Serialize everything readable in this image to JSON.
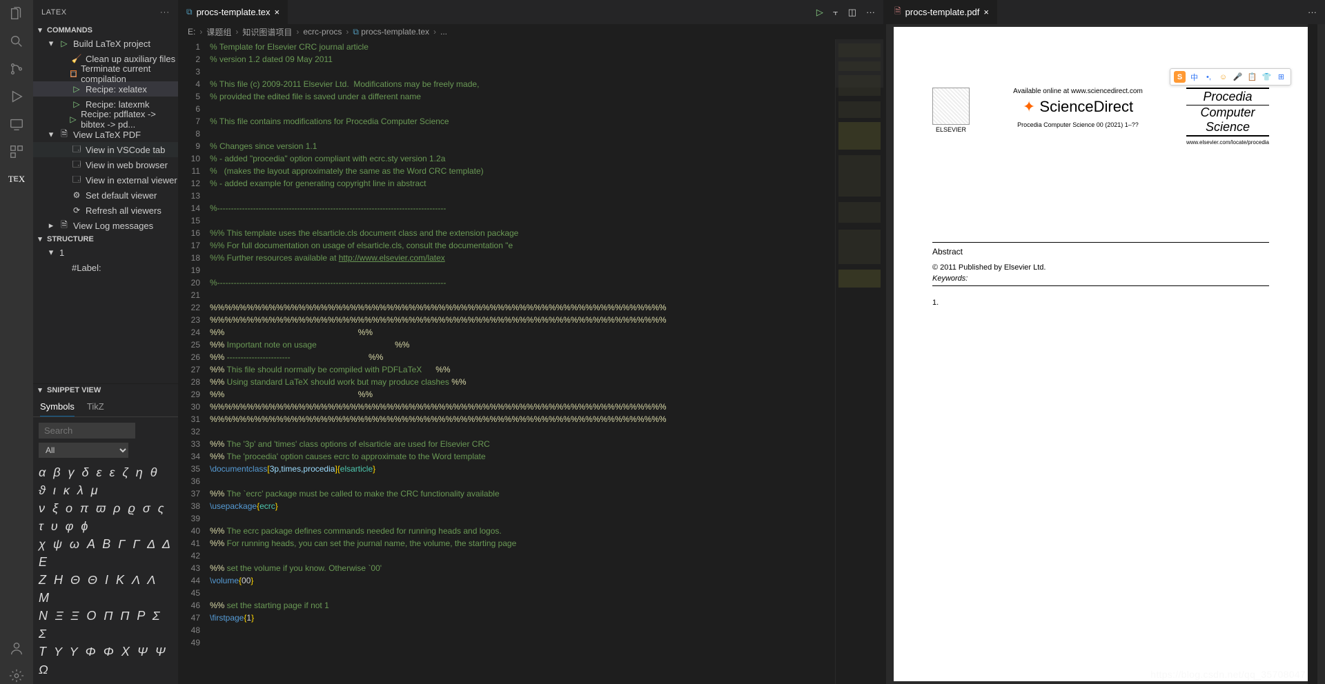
{
  "activity_icons": [
    "files",
    "search",
    "scm",
    "debug",
    "remote",
    "extensions",
    "tex"
  ],
  "activity_bottom": [
    "account",
    "settings"
  ],
  "sidebar": {
    "title": "LATEX",
    "commands_hdr": "COMMANDS",
    "structure_hdr": "STRUCTURE",
    "snippet_hdr": "SNIPPET VIEW",
    "tree": [
      {
        "chev": "▾",
        "icon": "▷",
        "iconCls": "play",
        "label": "Build LaTeX project"
      },
      {
        "chev": "",
        "icon": "🧹",
        "iconCls": "doc",
        "label": "Clean up auxiliary files",
        "child": true
      },
      {
        "chev": "",
        "icon": "□",
        "iconCls": "stop",
        "label": "Terminate current compilation",
        "child": true
      },
      {
        "chev": "",
        "icon": "▷",
        "iconCls": "play",
        "label": "Recipe: xelatex",
        "child": true,
        "sel": true
      },
      {
        "chev": "",
        "icon": "▷",
        "iconCls": "play",
        "label": "Recipe: latexmk",
        "child": true
      },
      {
        "chev": "",
        "icon": "▷",
        "iconCls": "play",
        "label": "Recipe: pdflatex -> bibtex -> pd...",
        "child": true
      },
      {
        "chev": "▾",
        "icon": "🗎",
        "iconCls": "doc",
        "label": "View LaTeX PDF"
      },
      {
        "chev": "",
        "icon": "🗔",
        "iconCls": "doc",
        "label": "View in VSCode tab",
        "child": true,
        "hover": true
      },
      {
        "chev": "",
        "icon": "🗔",
        "iconCls": "doc",
        "label": "View in web browser",
        "child": true
      },
      {
        "chev": "",
        "icon": "🗔",
        "iconCls": "doc",
        "label": "View in external viewer",
        "child": true
      },
      {
        "chev": "",
        "icon": "⚙",
        "iconCls": "gear",
        "label": "Set default viewer",
        "child": true
      },
      {
        "chev": "",
        "icon": "⟳",
        "iconCls": "refresh",
        "label": "Refresh all viewers",
        "child": true
      },
      {
        "chev": "▸",
        "icon": "🗎",
        "iconCls": "doc",
        "label": "View Log messages"
      }
    ],
    "structure": [
      {
        "chev": "▾",
        "label": "1"
      },
      {
        "chev": "",
        "label": "#Label:",
        "child": true
      }
    ],
    "snippet": {
      "tabs": [
        "Symbols",
        "TikZ"
      ],
      "search_ph": "Search",
      "filter_value": "All",
      "rows": [
        "α β γ δ ε ε ζ η θ ϑ ι κ λ μ",
        "ν ξ ο π ϖ ρ ϱ σ ς τ υ φ ϕ",
        "χ ψ ω A B Γ Γ Δ Δ E",
        "Z H Θ Θ I K Λ Λ M",
        "N Ξ Ξ O Π Π P Σ Σ",
        "T Υ Υ Φ Φ X Ψ Ψ Ω"
      ]
    }
  },
  "editor": {
    "tab_label": "procs-template.tex",
    "pdf_tab_label": "procs-template.pdf",
    "breadcrumb": [
      "E:",
      "课题组",
      "知识图谱项目",
      "ecrc-procs",
      "procs-template.tex",
      "..."
    ],
    "lines": [
      {
        "n": 1,
        "html": "<span class='c-comment'></span>"
      },
      {
        "n": 2,
        "html": "<span class='c-comment'>% Template for Elsevier CRC journal article</span>"
      },
      {
        "n": 3,
        "html": "<span class='c-comment'>% version 1.2 dated 09 May 2011</span>"
      },
      {
        "n": 4,
        "html": ""
      },
      {
        "n": 5,
        "html": "<span class='c-comment'>% This file (c) 2009-2011 Elsevier Ltd.  Modifications may be freely made,</span>"
      },
      {
        "n": 6,
        "html": "<span class='c-comment'>% provided the edited file is saved under a different name</span>"
      },
      {
        "n": 7,
        "html": ""
      },
      {
        "n": 8,
        "html": "<span class='c-comment'>% This file contains modifications for Procedia Computer Science</span>"
      },
      {
        "n": 9,
        "html": ""
      },
      {
        "n": 10,
        "html": "<span class='c-comment'>% Changes since version 1.1</span>"
      },
      {
        "n": 11,
        "html": "<span class='c-comment'>% - added \"procedia\" option compliant with ecrc.sty version 1.2a</span>"
      },
      {
        "n": 12,
        "html": "<span class='c-comment'>%   (makes the layout approximately the same as the Word CRC template)</span>"
      },
      {
        "n": 13,
        "html": "<span class='c-comment'>% - added example for generating copyright line in abstract</span>"
      },
      {
        "n": 14,
        "html": ""
      },
      {
        "n": 15,
        "html": "<span class='c-comment'>%-----------------------------------------------------------------------------------</span>"
      },
      {
        "n": 16,
        "html": ""
      },
      {
        "n": 17,
        "html": "<span class='c-comment'>%% This template uses the elsarticle.cls document class and the extension package</span>"
      },
      {
        "n": 18,
        "html": "<span class='c-comment'>%% For full documentation on usage of elsarticle.cls, consult the documentation \"e</span>"
      },
      {
        "n": 19,
        "html": "<span class='c-comment'>%% Further resources available at </span><span class='c-url'>http://www.elsevier.com/latex</span>"
      },
      {
        "n": 20,
        "html": ""
      },
      {
        "n": 21,
        "html": "<span class='c-comment'>%-----------------------------------------------------------------------------------</span>"
      },
      {
        "n": 22,
        "html": ""
      },
      {
        "n": 23,
        "html": "<span class='c-pct'>%%%%%%%%%%%%%%%%%%%%%%%%%%%%%%%%%%%%%%%%%%%%%%%%%%%%%%%%%%%%%%</span>"
      },
      {
        "n": 24,
        "html": "<span class='c-pct'>%%%%%%%%%%%%%%%%%%%%%%%%%%%%%%%%%%%%%%%%%%%%%%%%%%%%%%%%%%%%%%</span>"
      },
      {
        "n": 25,
        "html": "<span class='c-pct'>%%</span>                                                          <span class='c-pct'>%%</span>"
      },
      {
        "n": 26,
        "html": "<span class='c-pct'>%%</span><span class='c-comment'> Important note on usage                                  </span><span class='c-pct'>%%</span>"
      },
      {
        "n": 27,
        "html": "<span class='c-pct'>%%</span><span class='c-comment'> -----------------------                                  </span><span class='c-pct'>%%</span>"
      },
      {
        "n": 28,
        "html": "<span class='c-pct'>%%</span><span class='c-comment'> This file should normally be compiled with PDFLaTeX      </span><span class='c-pct'>%%</span>"
      },
      {
        "n": 29,
        "html": "<span class='c-pct'>%%</span><span class='c-comment'> Using standard LaTeX should work but may produce clashes </span><span class='c-pct'>%%</span>"
      },
      {
        "n": 30,
        "html": "<span class='c-pct'>%%</span>                                                          <span class='c-pct'>%%</span>"
      },
      {
        "n": 31,
        "html": "<span class='c-pct'>%%%%%%%%%%%%%%%%%%%%%%%%%%%%%%%%%%%%%%%%%%%%%%%%%%%%%%%%%%%%%%</span>"
      },
      {
        "n": 32,
        "html": "<span class='c-pct'>%%%%%%%%%%%%%%%%%%%%%%%%%%%%%%%%%%%%%%%%%%%%%%%%%%%%%%%%%%%%%%</span>"
      },
      {
        "n": 33,
        "html": ""
      },
      {
        "n": 34,
        "html": "<span class='c-pct'>%%</span><span class='c-comment'> The '3p' and 'times' class options of elsarticle are used for Elsevier CRC</span>"
      },
      {
        "n": 35,
        "html": "<span class='c-pct'>%%</span><span class='c-comment'> The 'procedia' option causes ecrc to approximate to the Word template</span>"
      },
      {
        "n": 36,
        "html": "<span class='c-cmd'>\\documentclass</span><span class='c-brack'>[</span><span class='c-argb'>3p,times,procedia</span><span class='c-brack'>]{</span><span class='c-arg'>elsarticle</span><span class='c-brack'>}</span>"
      },
      {
        "n": 37,
        "html": ""
      },
      {
        "n": 38,
        "html": "<span class='c-pct'>%%</span><span class='c-comment'> The `ecrc' package must be called to make the CRC functionality available</span>"
      },
      {
        "n": 39,
        "html": "<span class='c-cmd'>\\usepackage</span><span class='c-brack'>{</span><span class='c-arg'>ecrc</span><span class='c-brack'>}</span>"
      },
      {
        "n": 40,
        "html": ""
      },
      {
        "n": 41,
        "html": "<span class='c-pct'>%%</span><span class='c-comment'> The ecrc package defines commands needed for running heads and logos.</span>"
      },
      {
        "n": 42,
        "html": "<span class='c-pct'>%%</span><span class='c-comment'> For running heads, you can set the journal name, the volume, the starting page</span>"
      },
      {
        "n": 43,
        "html": ""
      },
      {
        "n": 44,
        "html": "<span class='c-pct'>%%</span><span class='c-comment'> set the volume if you know. Otherwise `00'</span>"
      },
      {
        "n": 45,
        "html": "<span class='c-cmd'>\\volume</span><span class='c-brack'>{</span>00<span class='c-brack'>}</span>"
      },
      {
        "n": 46,
        "html": ""
      },
      {
        "n": 47,
        "html": "<span class='c-pct'>%%</span><span class='c-comment'> set the starting page if not 1</span>"
      },
      {
        "n": 48,
        "html": "<span class='c-cmd'>\\firstpage</span><span class='c-brack'>{</span>1<span class='c-brack'>}</span>"
      },
      {
        "n": 49,
        "html": ""
      }
    ]
  },
  "pdf": {
    "elsevier": "ELSEVIER",
    "avail": "Available online at www.sciencedirect.com",
    "sd": "ScienceDirect",
    "pcs": "Procedia Computer Science 00 (2021) 1–??",
    "proc": [
      "Procedia",
      "Computer",
      "Science"
    ],
    "proc_url": "www.elsevier.com/locate/procedia",
    "abstract": "Abstract",
    "copyright": "© 2011 Published by Elsevier Ltd.",
    "keywords": "Keywords:",
    "pgnum": "1.",
    "ime": [
      "S",
      "中",
      "•,",
      "☺",
      "🎤",
      "📋",
      "👕",
      "⊞"
    ]
  },
  "watermark": "https://blog.csdn.net/qq_35708047"
}
